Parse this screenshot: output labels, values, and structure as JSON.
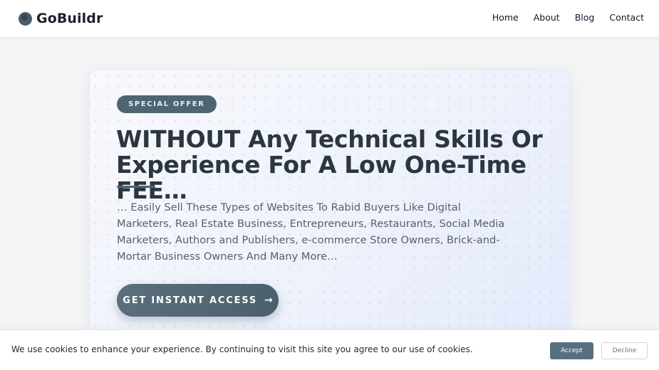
{
  "header": {
    "logo_text": "GoBuildr",
    "nav": [
      {
        "label": "Home"
      },
      {
        "label": "About"
      },
      {
        "label": "Blog"
      },
      {
        "label": "Contact"
      }
    ]
  },
  "hero": {
    "badge": "SPECIAL OFFER",
    "headline": "WITHOUT Any Technical Skills Or Experience For A Low One-Time FEE…",
    "description": "… Easily Sell These Types of Websites To Rabid Buyers Like Digital Marketers, Real Estate Business, Entrepreneurs, Restaurants, Social Media Marketers, Authors and Publishers, e-commerce Store Owners, Brick-and-Mortar Business Owners And Many More…",
    "cta_label": "GET INSTANT ACCESS",
    "cta_icon": "arrow-right-icon"
  },
  "cookie": {
    "text": "We use cookies to enhance your experience. By continuing to visit this site you agree to our use of cookies.",
    "accept_label": "Accept",
    "decline_label": "Decline"
  },
  "colors": {
    "accent": "#4e6572",
    "heading": "#2c3640",
    "page_bg": "#f3f4f6"
  }
}
